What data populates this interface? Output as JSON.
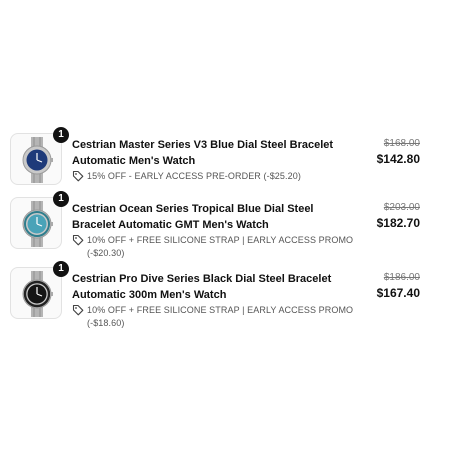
{
  "items": [
    {
      "quantity": "1",
      "title": "Cestrian Master Series V3 Blue Dial Steel Bracelet Automatic Men's Watch",
      "discount": "15% OFF - EARLY ACCESS PRE-ORDER (-$25.20)",
      "compare_price": "$168.00",
      "price": "$142.80",
      "dial_color": "#1e3a7a",
      "icon": "tag-icon"
    },
    {
      "quantity": "1",
      "title": "Cestrian Ocean Series Tropical Blue Dial Steel Bracelet Automatic GMT Men's Watch",
      "discount": "10% OFF + FREE SILICONE STRAP | EARLY ACCESS PROMO (-$20.30)",
      "compare_price": "$203.00",
      "price": "$182.70",
      "dial_color": "#4aa3b8",
      "icon": "tag-icon"
    },
    {
      "quantity": "1",
      "title": "Cestrian Pro Dive Series Black Dial Steel Bracelet Automatic 300m Men's Watch",
      "discount": "10% OFF + FREE SILICONE STRAP | EARLY ACCESS PROMO (-$18.60)",
      "compare_price": "$186.00",
      "price": "$167.40",
      "dial_color": "#151515",
      "icon": "tag-icon"
    }
  ]
}
